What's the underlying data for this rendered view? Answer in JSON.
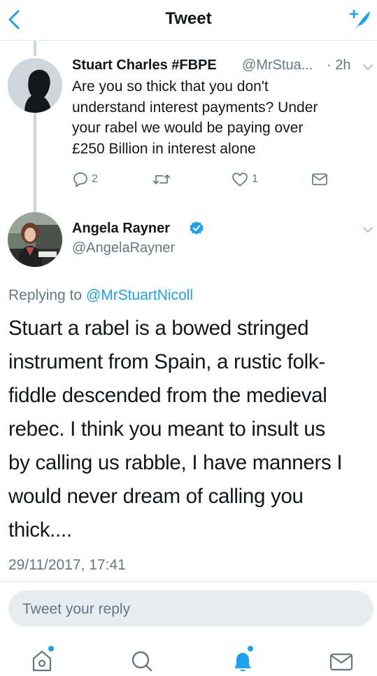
{
  "header": {
    "title": "Tweet"
  },
  "parent_tweet": {
    "name": "Stuart Charles #FBPE",
    "handle": "@MrStua...",
    "time": "· 2h",
    "text_lines": [
      "Are you so thick that you don't",
      "understand interest payments? Under",
      "your rabel we would be paying over",
      "£250 Billion in interest alone"
    ],
    "reply_count": "2",
    "retweet_count": "",
    "like_count": "1"
  },
  "main_tweet": {
    "name": "Angela Rayner",
    "handle": "@AngelaRayner",
    "replying_prefix": "Replying to",
    "replying_to": "@MrStuartNicoll",
    "text_lines": [
      "Stuart a rabel is a bowed stringed",
      "instrument from Spain, a rustic folk-",
      "fiddle descended from the medieval",
      "rebec. I think you meant to insult us",
      "by calling us rabble, I have manners I",
      "would never dream of calling you",
      "thick...."
    ],
    "timestamp": "29/11/2017, 17:41"
  },
  "reply_box": {
    "placeholder": "Tweet your reply"
  },
  "tabs": [
    "home-icon",
    "search-icon",
    "notifications-icon",
    "messages-icon"
  ],
  "colors": {
    "accent": "#1da1f2",
    "muted": "#657786",
    "divider": "#e1e8ed",
    "verified": "#1da1f2"
  }
}
